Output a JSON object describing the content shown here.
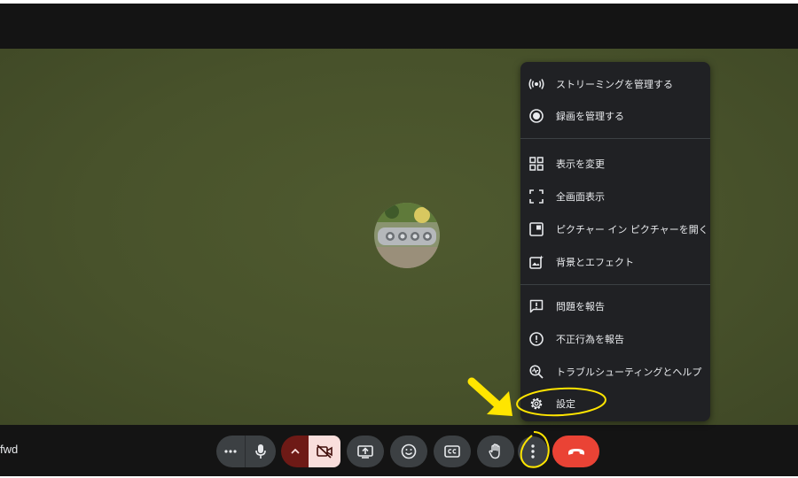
{
  "meeting": {
    "code_fragment": "fwd"
  },
  "menu": {
    "items": [
      {
        "label": "ストリーミングを管理する",
        "icon": "streaming-icon"
      },
      {
        "label": "録画を管理する",
        "icon": "record-icon"
      },
      {
        "label": "表示を変更",
        "icon": "layout-grid-icon"
      },
      {
        "label": "全画面表示",
        "icon": "fullscreen-icon"
      },
      {
        "label": "ピクチャー イン ピクチャーを開く",
        "icon": "picture-in-picture-icon"
      },
      {
        "label": "背景とエフェクト",
        "icon": "background-effects-icon"
      },
      {
        "label": "問題を報告",
        "icon": "feedback-icon"
      },
      {
        "label": "不正行為を報告",
        "icon": "report-abuse-icon"
      },
      {
        "label": "トラブルシューティングとヘルプ",
        "icon": "troubleshoot-icon"
      },
      {
        "label": "設定",
        "icon": "gear-icon"
      }
    ]
  },
  "controls": [
    {
      "name": "more-audio-options",
      "icon": "ellipsis-icon"
    },
    {
      "name": "microphone",
      "icon": "microphone-icon"
    },
    {
      "name": "camera-options",
      "icon": "chevron-up-icon"
    },
    {
      "name": "camera-toggle",
      "icon": "camera-off-icon",
      "state": "off"
    },
    {
      "name": "present-screen",
      "icon": "present-icon"
    },
    {
      "name": "reactions",
      "icon": "emoji-icon"
    },
    {
      "name": "captions",
      "icon": "captions-icon"
    },
    {
      "name": "raise-hand",
      "icon": "hand-icon"
    },
    {
      "name": "more-options",
      "icon": "vertical-dots-icon"
    },
    {
      "name": "leave-call",
      "icon": "hangup-icon"
    }
  ],
  "colors": {
    "stage_background": "#48522b",
    "control_background": "#3c4043",
    "menu_background": "#202124",
    "camera_off_dark": "#6e1a16",
    "camera_off_light": "#f9dedc",
    "hangup_red": "#ea4335",
    "annotation_yellow": "#ffe500"
  }
}
